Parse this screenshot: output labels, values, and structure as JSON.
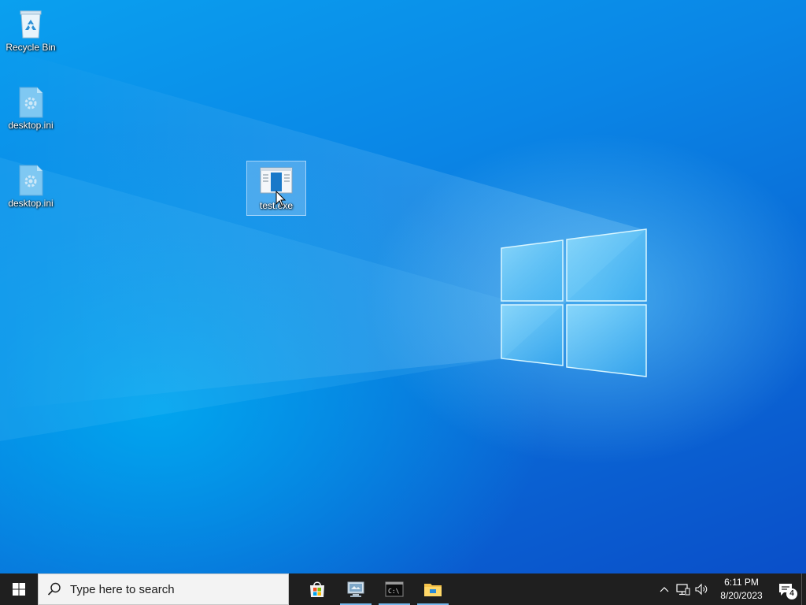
{
  "desktop": {
    "icons": [
      {
        "label": "Recycle Bin",
        "icon": "recycle-bin-icon"
      },
      {
        "label": "desktop.ini",
        "icon": "settings-file-icon"
      },
      {
        "label": "desktop.ini",
        "icon": "settings-file-icon"
      },
      {
        "label": "test.exe",
        "icon": "application-icon",
        "selected": true
      }
    ]
  },
  "taskbar": {
    "start_icon": "windows-logo-icon",
    "search_placeholder": "Type here to search",
    "apps": [
      {
        "name": "Microsoft Store",
        "icon": "store-icon",
        "running": false
      },
      {
        "name": "Remote Desktop",
        "icon": "remote-desktop-icon",
        "running": true
      },
      {
        "name": "Command Prompt",
        "icon": "command-prompt-icon",
        "running": true
      },
      {
        "name": "File Explorer",
        "icon": "file-explorer-icon",
        "running": true
      }
    ],
    "tray": {
      "time": "6:11 PM",
      "date": "8/20/2023",
      "notification_count": "4"
    }
  },
  "colors": {
    "taskbar": "#1f1f1f",
    "running_indicator": "#76b9ed",
    "desktop_blue": "#0a86e6"
  }
}
